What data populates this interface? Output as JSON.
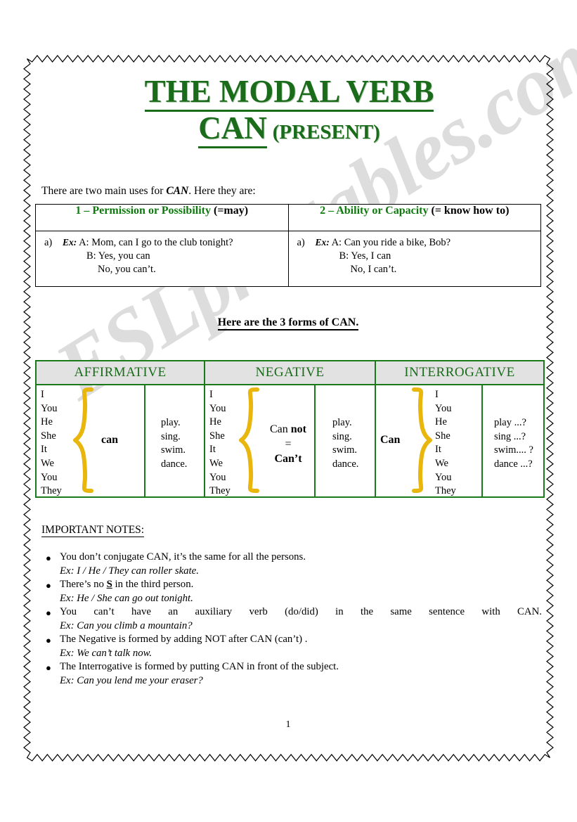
{
  "document": {
    "title_line1": "THE MODAL VERB",
    "title_can": "CAN",
    "title_present": "(PRESENT)",
    "page_number": "1",
    "watermark": "ESLprintables.com",
    "accent_green": "#1a6b1a",
    "brace_yellow": "#e8b60c",
    "header_gray": "#e2e2e2"
  },
  "intro": {
    "before": "There are two main uses for ",
    "emphasis": "CAN",
    "after": ". Here they are:"
  },
  "uses_table": {
    "columns": [
      {
        "heading_strong": "1 – Permission or Possibility",
        "heading_plain": "(=may)",
        "marker": "a)",
        "ex_label": "Ex:",
        "line1": "A: Mom, can I go to the club tonight?",
        "line2": "B: Yes, you can",
        "line3": "No, you can’t."
      },
      {
        "heading_strong": "2 – Ability or Capacity",
        "heading_plain": "(= know how to)",
        "marker": "a)",
        "ex_label": "Ex:",
        "line1": "A: Can you ride a bike, Bob?",
        "line2": "B: Yes, I can",
        "line3": "No, I can’t."
      }
    ]
  },
  "forms_heading": "Here are the 3 forms of CAN.",
  "forms_table": {
    "headers": [
      "AFFIRMATIVE",
      "NEGATIVE",
      "INTERROGATIVE"
    ],
    "pronouns": [
      "I",
      "You",
      "He",
      "She",
      "It",
      "We",
      "You",
      "They"
    ],
    "affirmative": {
      "modal": "can",
      "verbs": [
        "play.",
        "sing.",
        "swim.",
        "dance."
      ]
    },
    "negative": {
      "modal_part1": "Can",
      "modal_part2": "not",
      "equals": "=",
      "contraction": "Can’t",
      "verbs": [
        "play.",
        "sing.",
        "swim.",
        "dance."
      ]
    },
    "interrogative": {
      "modal": "Can",
      "verbs": [
        "play ...?",
        "sing   ...?",
        "swim.... ?",
        "dance ...?"
      ]
    }
  },
  "notes": {
    "title": "IMPORTANT NOTES:",
    "items": [
      {
        "main_before": "You don’t conjugate CAN, it’s the same for all the persons.",
        "underline": "",
        "main_after": "",
        "example": "Ex: I / He / They can roller skate.",
        "justify": false
      },
      {
        "main_before": "There’s no ",
        "underline": "S",
        "main_after": " in the third person.",
        "example": "Ex: He / She can go out tonight.",
        "justify": false
      },
      {
        "main_before": "You can’t have an auxiliary verb (do/did) in the same sentence with CAN.",
        "underline": "",
        "main_after": "",
        "example": "Ex: Can you climb a mountain?",
        "justify": true
      },
      {
        "main_before": "The Negative is formed by adding NOT after CAN (can’t) .",
        "underline": "",
        "main_after": "",
        "example": "Ex: We can’t talk now.",
        "justify": false
      },
      {
        "main_before": "The Interrogative is formed by putting CAN in front of the subject.",
        "underline": "",
        "main_after": "",
        "example": "Ex: Can you lend me your eraser?",
        "justify": false
      }
    ],
    "bullet_glyph": "●"
  }
}
